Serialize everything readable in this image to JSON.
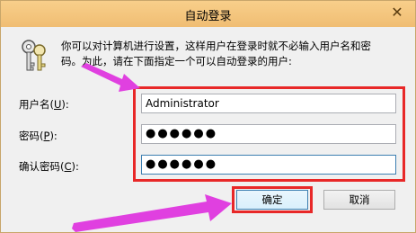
{
  "window": {
    "title": "自动登录"
  },
  "icons": {
    "close": "close-icon",
    "keys": "keys-icon"
  },
  "message": {
    "line1": "你可以对计算机进行设置，这样用户在登录时就不必输入用户名和密",
    "line2": "码。为此，请在下面指定一个可以自动登录的用户:"
  },
  "fields": {
    "username": {
      "label_pre": "用户名(",
      "label_key": "U",
      "label_post": "):",
      "value": "Administrator"
    },
    "password": {
      "label_pre": "密码(",
      "label_key": "P",
      "label_post": "):",
      "value": "●●●●●●"
    },
    "confirm": {
      "label_pre": "确认密码(",
      "label_key": "C",
      "label_post": "):",
      "value": "●●●●●●"
    }
  },
  "buttons": {
    "ok": "确定",
    "cancel": "取消"
  },
  "colors": {
    "highlight": "#e82828",
    "arrow": "#e040e0",
    "titlebar": "#f0bd73"
  }
}
